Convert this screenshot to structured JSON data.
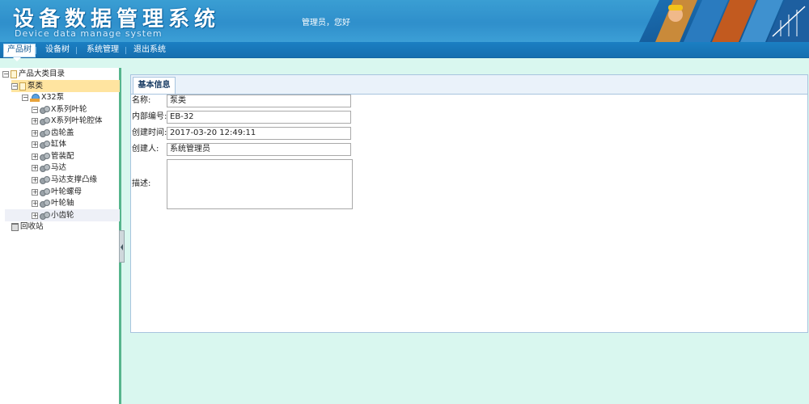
{
  "header": {
    "title": "设备数据管理系统",
    "subtitle": "Device data manage system",
    "welcome": "管理员，您好"
  },
  "nav": {
    "items": [
      {
        "label": "产品树",
        "active": true
      },
      {
        "label": "设备树",
        "active": false
      },
      {
        "label": "系统管理",
        "active": false
      },
      {
        "label": "退出系统",
        "active": false
      }
    ]
  },
  "tree": {
    "root": "产品大类目录",
    "selected": "泵类",
    "group": "X32泵",
    "children": [
      "X系列叶轮",
      "X系列叶轮腔体",
      "齿轮盖",
      "缸体",
      "管装配",
      "马达",
      "马达支撑凸缘",
      "叶轮螺母",
      "叶轮轴",
      "小齿轮"
    ],
    "recycle": "回收站"
  },
  "detail": {
    "tab": "基本信息",
    "fields": {
      "name_label": "名称:",
      "name_value": "泵类",
      "code_label": "内部编号:",
      "code_value": "EB-32",
      "created_label": "创建时间:",
      "created_value": "2017-03-20 12:49:11",
      "creator_label": "创建人:",
      "creator_value": "系统管理员",
      "desc_label": "描述:",
      "desc_value": ""
    }
  },
  "colors": {
    "header_blue": "#3a9ed3",
    "nav_blue": "#1b7fc3",
    "content_bg": "#d9f7ef",
    "selection": "#ffe4a0"
  }
}
